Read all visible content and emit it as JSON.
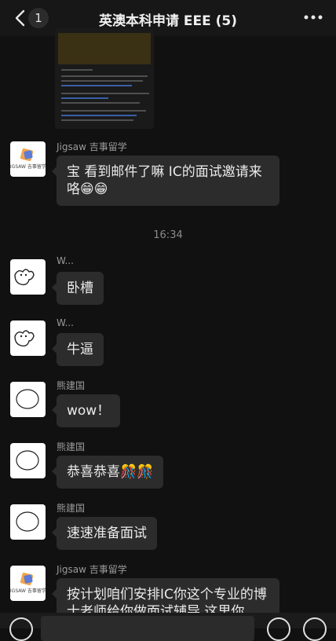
{
  "header": {
    "badge_count": "1",
    "title": "英澳本科申请 EEE (5)"
  },
  "timestamp": "16:34",
  "messages": [
    {
      "sender": "Jigsaw 吉事留学",
      "text": "宝 看到邮件了嘛 IC的面试邀请来咯😁😁",
      "logo_text": "JIGSAW 吉事留学"
    },
    {
      "sender": "W...",
      "text": "卧槽"
    },
    {
      "sender": "W...",
      "text": "牛逼"
    },
    {
      "sender": "熊建国",
      "text": "wow！"
    },
    {
      "sender": "熊建国",
      "text": "恭喜恭喜🎊🎊"
    },
    {
      "sender": "熊建国",
      "text": "速速准备面试"
    },
    {
      "sender": "Jigsaw 吉事留学",
      "text": "按计划咱们安排IC你这个专业的博士老师给你做面试辅导 这里你",
      "logo_text": "JIGSAW 吉事留学"
    }
  ]
}
